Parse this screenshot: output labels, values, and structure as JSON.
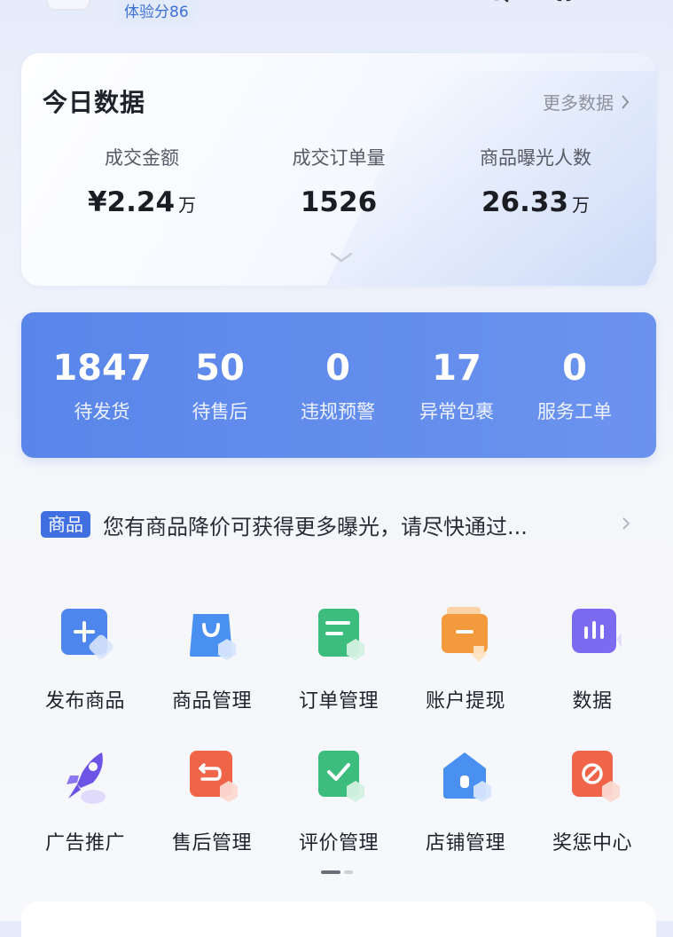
{
  "header": {
    "score_badge": "体验分86",
    "icons": [
      "search-icon",
      "headset-icon",
      "message-icon"
    ]
  },
  "today": {
    "title": "今日数据",
    "more_label": "更多数据",
    "metrics": [
      {
        "label": "成交金额",
        "value": "¥2.24",
        "unit": "万"
      },
      {
        "label": "成交订单量",
        "value": "1526",
        "unit": ""
      },
      {
        "label": "商品曝光人数",
        "value": "26.33",
        "unit": "万"
      }
    ]
  },
  "stats": [
    {
      "value": "1847",
      "label": "待发货"
    },
    {
      "value": "50",
      "label": "待售后"
    },
    {
      "value": "0",
      "label": "违规预警"
    },
    {
      "value": "17",
      "label": "异常包裹"
    },
    {
      "value": "0",
      "label": "服务工单"
    }
  ],
  "notice": {
    "tag": "商品",
    "text": "您有商品降价可获得更多曝光，请尽快通过..."
  },
  "features": [
    {
      "label": "发布商品",
      "icon": "publish-product-icon",
      "color": "#4f86ee"
    },
    {
      "label": "商品管理",
      "icon": "shopping-bag-icon",
      "color": "#4a90f0"
    },
    {
      "label": "订单管理",
      "icon": "order-list-icon",
      "color": "#3dbd7d"
    },
    {
      "label": "账户提现",
      "icon": "wallet-icon",
      "color": "#f39a3c"
    },
    {
      "label": "数据",
      "icon": "bar-chart-icon",
      "color": "#7b6bf0"
    },
    {
      "label": "广告推广",
      "icon": "rocket-icon",
      "color": "#6d54e6"
    },
    {
      "label": "售后管理",
      "icon": "return-icon",
      "color": "#f0644a"
    },
    {
      "label": "评价管理",
      "icon": "review-check-icon",
      "color": "#3dbd7d"
    },
    {
      "label": "店铺管理",
      "icon": "store-icon",
      "color": "#4a90f0"
    },
    {
      "label": "奖惩中心",
      "icon": "prohibit-icon",
      "color": "#f0644a"
    }
  ],
  "pager": {
    "pages": 2,
    "current": 1
  }
}
